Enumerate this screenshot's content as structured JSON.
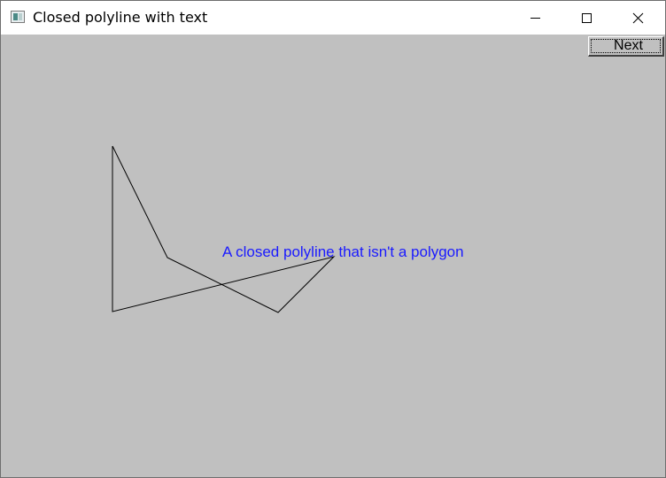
{
  "window": {
    "title": "Closed polyline with text",
    "controls": {
      "minimize": "minimize-icon",
      "maximize": "maximize-icon",
      "close": "close-icon"
    }
  },
  "toolbar": {
    "next_label": "Next"
  },
  "drawing": {
    "caption": "A closed polyline that isn't a polygon",
    "caption_color": "#1a1aff",
    "line_color": "#000000",
    "background_color": "#c0c0c0"
  }
}
